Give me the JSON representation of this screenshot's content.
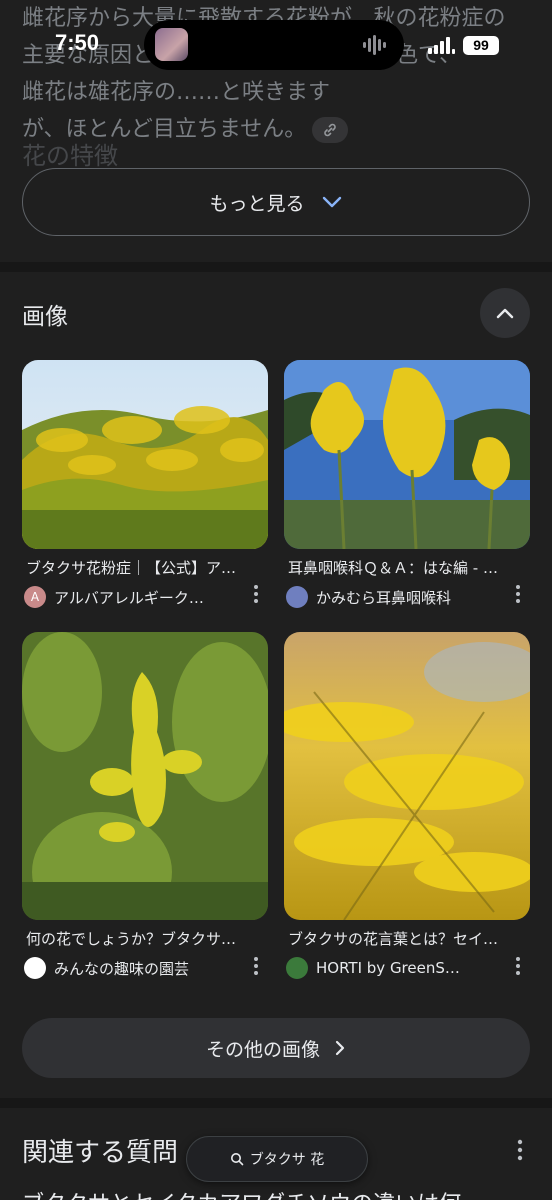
{
  "status_bar": {
    "time": "7:50",
    "battery": "99"
  },
  "snippet": {
    "lines": [
      "雌花序から大量に飛散する花粉が、秋の花粉症の",
      "主要な原因と……。花は淡緑色や黄緑色で、",
      "雌花は雄花序の……と咲きます",
      "が、ほとんど目立ちません。"
    ],
    "faded_heading": "花の特徴",
    "more_button": "もっと見る"
  },
  "images": {
    "section_title": "画像",
    "cards": [
      {
        "caption": "ブタクサ花粉症｜【公式】ア…",
        "source": "アルバアレルギーク…",
        "favicon_letter": "A",
        "favicon_color": "#c98a8a"
      },
      {
        "caption": "耳鼻咽喉科Ｑ＆Ａ：はな編 - …",
        "source": "かみむら耳鼻咽喉科",
        "favicon_letter": "",
        "favicon_color": "#6f7fbf"
      },
      {
        "caption": "何の花でしょうか？ブタクサ…",
        "source": "みんなの趣味の園芸",
        "favicon_letter": "",
        "favicon_color": "#ffffff"
      },
      {
        "caption": "ブタクサの花言葉とは？セイ…",
        "source": "HORTI by GreenS…",
        "favicon_letter": "",
        "favicon_color": "#3b7a3b"
      }
    ],
    "other_button": "その他の画像"
  },
  "related": {
    "title": "関連する質問",
    "first_question": "ブタクサとセイタカアワダチソウの違いは何…"
  },
  "search_pill": {
    "query": "ブタクサ 花"
  },
  "colors": {
    "background": "#1f1f1f",
    "section_divider": "#171717",
    "button_fill": "#303134",
    "text_primary": "#e8eaed",
    "text_secondary": "#9aa0a6",
    "accent_chevron": "#8ab4f8"
  }
}
